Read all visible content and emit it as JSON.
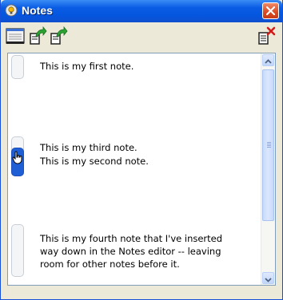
{
  "window": {
    "title": "Notes",
    "app_icon": "notes-app-icon",
    "close_icon": "close-icon"
  },
  "toolbar": {
    "buttons": [
      {
        "name": "show-notes-pane",
        "icon": "pane-icon"
      },
      {
        "name": "export-notes",
        "icon": "export-icon"
      },
      {
        "name": "export-notes-alt",
        "icon": "export-alt-icon"
      },
      {
        "name": "delete-note",
        "icon": "delete-note-icon"
      }
    ]
  },
  "notes": [
    {
      "text": "This is my first note."
    },
    {
      "text": "This is my third note."
    },
    {
      "text": "This is my second note."
    },
    {
      "lines": [
        "This is my fourth note that I've inserted",
        "way down in the Notes editor -- leaving",
        "room for other notes before it."
      ]
    }
  ],
  "colors": {
    "titlebar": "#0a5ce4",
    "active_marker": "#1f5fd6",
    "close": "#d94a22"
  }
}
